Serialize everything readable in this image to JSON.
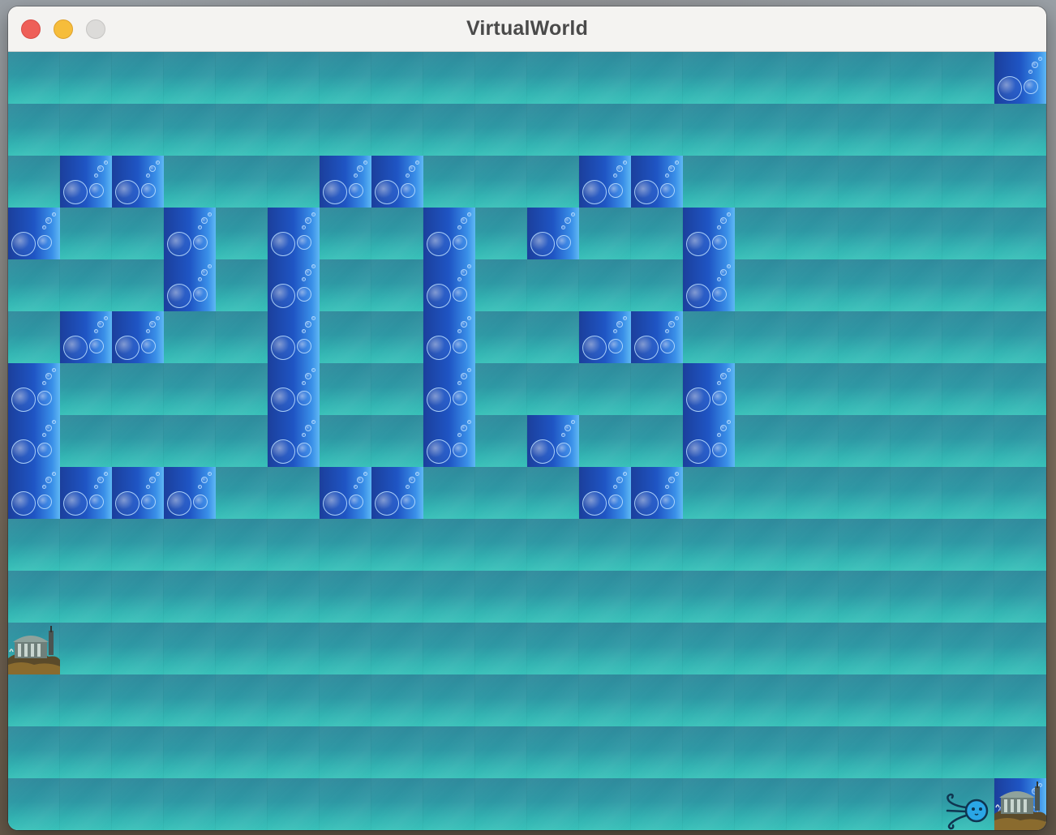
{
  "window": {
    "title": "VirtualWorld"
  },
  "world": {
    "cols": 20,
    "rows": 15,
    "obstacles": [
      [
        19,
        0
      ],
      [
        1,
        2
      ],
      [
        2,
        2
      ],
      [
        6,
        2
      ],
      [
        7,
        2
      ],
      [
        11,
        2
      ],
      [
        12,
        2
      ],
      [
        0,
        3
      ],
      [
        3,
        3
      ],
      [
        5,
        3
      ],
      [
        8,
        3
      ],
      [
        10,
        3
      ],
      [
        13,
        3
      ],
      [
        3,
        4
      ],
      [
        5,
        4
      ],
      [
        8,
        4
      ],
      [
        13,
        4
      ],
      [
        1,
        5
      ],
      [
        2,
        5
      ],
      [
        5,
        5
      ],
      [
        8,
        5
      ],
      [
        11,
        5
      ],
      [
        12,
        5
      ],
      [
        0,
        6
      ],
      [
        5,
        6
      ],
      [
        8,
        6
      ],
      [
        13,
        6
      ],
      [
        0,
        7
      ],
      [
        5,
        7
      ],
      [
        8,
        7
      ],
      [
        10,
        7
      ],
      [
        13,
        7
      ],
      [
        0,
        8
      ],
      [
        1,
        8
      ],
      [
        2,
        8
      ],
      [
        3,
        8
      ],
      [
        6,
        8
      ],
      [
        7,
        8
      ],
      [
        11,
        8
      ],
      [
        12,
        8
      ]
    ],
    "obstacle_cells_with_temple": [
      [
        19,
        14
      ]
    ],
    "temples": [
      [
        0,
        11
      ],
      [
        19,
        14
      ]
    ],
    "creatures": [
      [
        18,
        14
      ]
    ]
  },
  "icons": {
    "sea": "sea-tile",
    "obstacle": "bubble-obstacle",
    "temple": "temple-icon",
    "creature": "octopus-creature-icon"
  },
  "colors": {
    "sea_top": "#2f8a9c",
    "sea_bottom": "#37c0b8",
    "obstacle_dark": "#1b3f9c",
    "obstacle_light": "#5fb8f4",
    "creature": "#2aa6e6",
    "close": "#ee5f58",
    "minimize": "#f6bd3b",
    "zoom": "#dcdbd9"
  }
}
